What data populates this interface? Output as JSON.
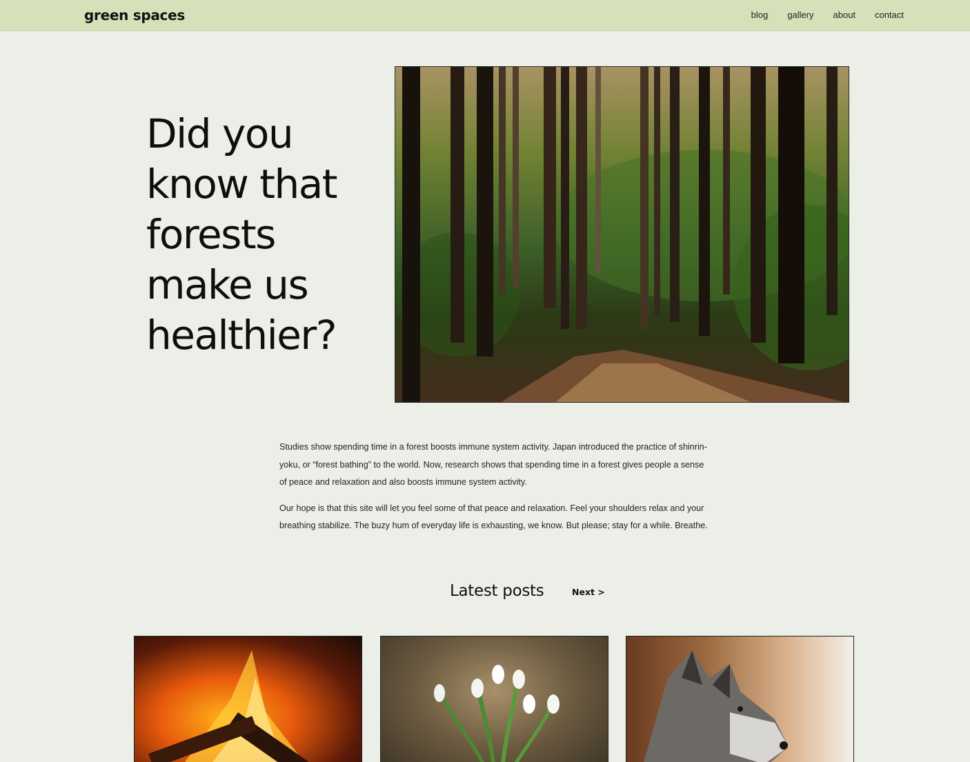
{
  "header": {
    "brand": "green spaces",
    "nav": [
      "blog",
      "gallery",
      "about",
      "contact"
    ]
  },
  "hero": {
    "title": "Did you know that forests make us healthier?"
  },
  "intro": {
    "paragraphs": [
      "Studies show spending time in a forest boosts immune system activity. Japan introduced the practice of shinrin-yoku, or “forest bathing” to the world. Now, research shows that spending time in a forest gives people a sense of peace and relaxation and also boosts immune system activity.",
      "Our hope is that this site will let you feel some of that peace and relaxation. Feel your shoulders relax and your breathing stabilize. The buzy hum of everyday life is exhausting, we know. But please; stay for a while. Breathe."
    ]
  },
  "posts": {
    "title": "Latest posts",
    "next_label": "Next >"
  },
  "colors": {
    "background": "#ebefe8",
    "topbar": "#d5e1b9"
  },
  "icons": {
    "hero_image": "forest-path-photo",
    "post_images": [
      "campfire-photo",
      "snowdrop-flowers-photo",
      "wolf-photo"
    ]
  }
}
